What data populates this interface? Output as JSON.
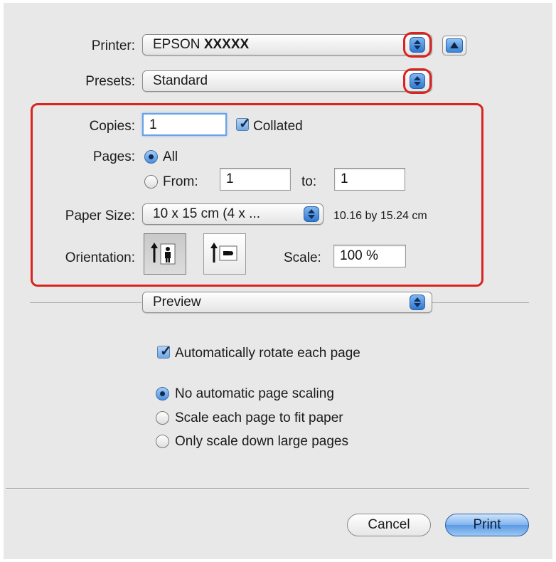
{
  "printer": {
    "label": "Printer:",
    "value_prefix": "EPSON",
    "value_model": "XXXXX"
  },
  "presets": {
    "label": "Presets:",
    "value": "Standard"
  },
  "copies": {
    "label": "Copies:",
    "value": "1",
    "collated_label": "Collated",
    "collated_checked": true
  },
  "pages": {
    "label": "Pages:",
    "all_label": "All",
    "from_label": "From:",
    "from_value": "1",
    "to_label": "to:",
    "to_value": "1",
    "selected": "All"
  },
  "paper_size": {
    "label": "Paper Size:",
    "value": "10 x 15 cm (4 x ...",
    "dimensions": "10.16 by 15.24 cm"
  },
  "orientation": {
    "label": "Orientation:",
    "selected": "portrait"
  },
  "scale": {
    "label": "Scale:",
    "value": "100 %"
  },
  "section_popup": {
    "value": "Preview"
  },
  "preview_options": {
    "auto_rotate_label": "Automatically rotate each page",
    "auto_rotate_checked": true,
    "scaling_options": [
      "No automatic page scaling",
      "Scale each page to fit paper",
      "Only scale down large pages"
    ],
    "scaling_selected": 0
  },
  "buttons": {
    "cancel": "Cancel",
    "print": "Print"
  },
  "colors": {
    "highlight": "#d9241f",
    "accent": "#4b8ee0"
  }
}
